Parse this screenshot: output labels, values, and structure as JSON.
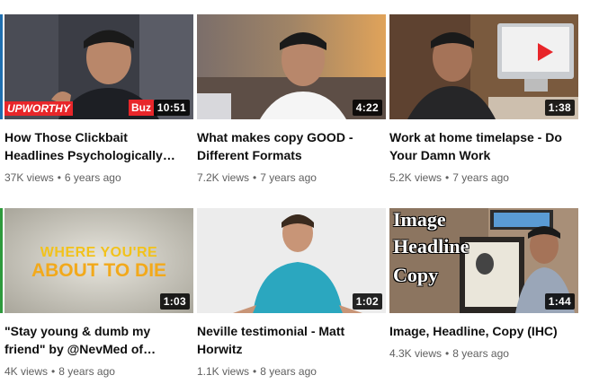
{
  "videos": [
    {
      "title": "How Those Clickbait Headlines Psychologically…",
      "views": "37K views",
      "age": "6 years ago",
      "duration": "10:51",
      "thumb_overlay_left": "UPWORTHY",
      "thumb_overlay_right": "Buz"
    },
    {
      "title": "What makes copy GOOD - Different Formats",
      "views": "7.2K views",
      "age": "7 years ago",
      "duration": "4:22"
    },
    {
      "title": "Work at home timelapse - Do Your Damn Work",
      "views": "5.2K views",
      "age": "7 years ago",
      "duration": "1:38"
    },
    {
      "title": "\"Stay young & dumb my friend\" by @NevMed of…",
      "views": "4K views",
      "age": "8 years ago",
      "duration": "1:03",
      "thumb_text_line1": "WHERE YOU'RE",
      "thumb_text_line2": "ABOUT TO DIE"
    },
    {
      "title": "Neville testimonial - Matt Horwitz",
      "views": "1.1K views",
      "age": "8 years ago",
      "duration": "1:02"
    },
    {
      "title": "Image, Headline, Copy (IHC)",
      "views": "4.3K views",
      "age": "8 years ago",
      "duration": "1:44",
      "thumb_text_line1": "Image",
      "thumb_text_line2": "Headline",
      "thumb_text_line3": "Copy"
    }
  ],
  "colors": {
    "title": "#0f0f0f",
    "meta": "#606060",
    "duration_bg": "#000000",
    "duration_text": "#ffffff",
    "upworthy_red": "#e8262a",
    "green_accent": "#2e9a3c"
  },
  "separator": "•"
}
